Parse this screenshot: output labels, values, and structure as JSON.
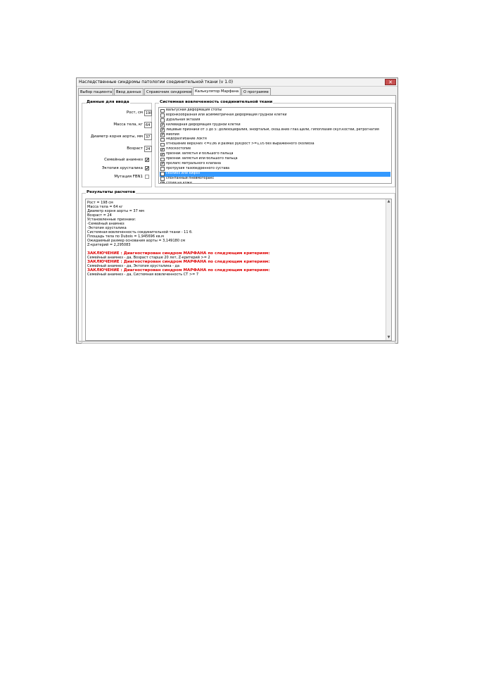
{
  "window": {
    "title": "Наследственные синдромы патологии соединительной ткани (v 1.0)",
    "close_glyph": "✕"
  },
  "tabs": [
    {
      "label": "Выбор пациента"
    },
    {
      "label": "Ввод данных"
    },
    {
      "label": "Справочник синдромов"
    },
    {
      "label": "Калькулятор Марфана",
      "active": true
    },
    {
      "label": "О программе"
    }
  ],
  "input_group": {
    "title": "Данные для ввода",
    "fields": [
      {
        "label": "Рост, см",
        "value": "198"
      },
      {
        "label": "Масса тела, кг",
        "value": "64"
      },
      {
        "label": "Диаметр корня аорты, мм",
        "value": "37"
      },
      {
        "label": "Возраст",
        "value": "24"
      }
    ],
    "checks": [
      {
        "label": "Семейный анамнез",
        "checked": true
      },
      {
        "label": "Эктопия хрусталика",
        "checked": true
      },
      {
        "label": "Мутация FBN1",
        "checked": false
      }
    ]
  },
  "systemic_group": {
    "title": "Системная вовлеченность соединительной ткани",
    "items": [
      {
        "label": "вальгусная деформация стопы",
        "checked": false
      },
      {
        "label": "воронкообразная или асимметричная деформация грудной клетки",
        "checked": false
      },
      {
        "label": "дуральная эктазия",
        "checked": false
      },
      {
        "label": "килевидная деформация грудной клетки",
        "checked": true
      },
      {
        "label": "лицевые признаки от 3 до 5: долихоцефалия, энофтальм, скош.вниз глаз.щели, гипоплазия скул.костей, ретрогнатия",
        "checked": true
      },
      {
        "label": "миопия",
        "checked": true
      },
      {
        "label": "недоразгибание локтя",
        "checked": false
      },
      {
        "label": "отношение верх/низ <=0,86 и размах рук/рост >=1,05 без выраженного сколиоза",
        "checked": false
      },
      {
        "label": "плоскостопие",
        "checked": true
      },
      {
        "label": "признак запястья и большого пальца",
        "checked": true
      },
      {
        "label": "признак запястья или большого пальца",
        "checked": false
      },
      {
        "label": "пролапс митрального клапана",
        "checked": true
      },
      {
        "label": "протрузия тазобедренного сустава",
        "checked": false
      },
      {
        "label": "сколиоз или кифоз",
        "checked": true,
        "selected": true
      },
      {
        "label": "спонтанный пневмоторакс",
        "checked": false
      },
      {
        "label": "стрии на коже",
        "checked": true
      }
    ]
  },
  "results_group": {
    "title": "Результаты расчетов",
    "lines": [
      {
        "text": "Рост = 198 см",
        "style": "normal"
      },
      {
        "text": "Масса тела = 64 кг",
        "style": "normal"
      },
      {
        "text": " Диаметр корня аорты = 37 мм",
        "style": "normal"
      },
      {
        "text": "Возраст = 24",
        "style": "normal"
      },
      {
        "text": "Установленные признаки:",
        "style": "normal"
      },
      {
        "text": "  -Семейный анамнез",
        "style": "normal"
      },
      {
        "text": "  -Эктопия хрусталика",
        "style": "normal"
      },
      {
        "text": "Системная вовлеченность соединительной ткани - 11 б.",
        "style": "normal"
      },
      {
        "text": "Площадь тела по Dubois = 1,945696 кв.м",
        "style": "normal"
      },
      {
        "text": "Ожидаемый размер основания аорты = 3,149180 см",
        "style": "normal"
      },
      {
        "text": "Z-критерий = 2,295083",
        "style": "normal"
      },
      {
        "text": "",
        "style": "gap"
      },
      {
        "text": "ЗАКЛЮЧЕНИЕ : Диагностирован синдром МАРФАНА по следующим критериям:",
        "style": "red"
      },
      {
        "text": "  Семейный анамнез - да, Возраст старше 20 лет, Z-критерий >= 2",
        "style": "normal"
      },
      {
        "text": "ЗАКЛЮЧЕНИЕ : Диагностирован синдром МАРФАНА по следующим критериям:",
        "style": "red"
      },
      {
        "text": "  Семейный анамнез - да, Эктопия хрусталика - да",
        "style": "normal"
      },
      {
        "text": "ЗАКЛЮЧЕНИЕ : Диагностирован синдром МАРФАНА по следующим критериям:",
        "style": "red"
      },
      {
        "text": "  Семейный анамнез - да, Системная вовлеченность СТ >= 7",
        "style": "normal"
      }
    ]
  },
  "scrollbar": {
    "up_glyph": "▲",
    "down_glyph": "▼"
  },
  "check_glyph": "✔"
}
